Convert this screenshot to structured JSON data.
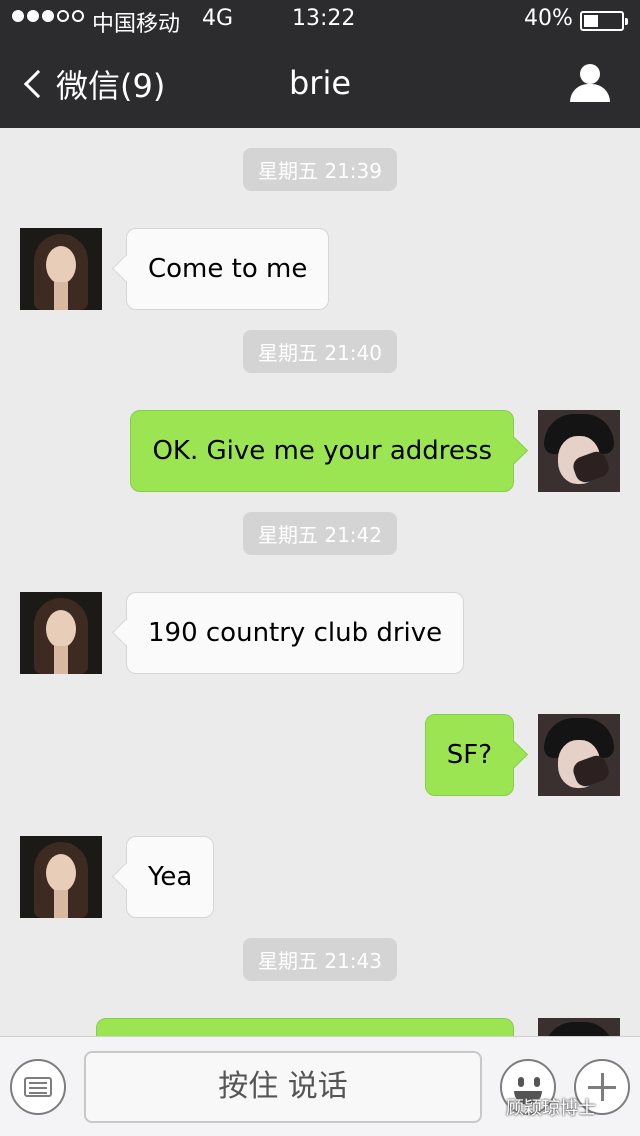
{
  "status_bar": {
    "signal_dots_filled": 3,
    "signal_dots_total": 5,
    "carrier": "中国移动",
    "network": "4G",
    "time": "13:22",
    "battery_percent_text": "40%",
    "battery_level": 0.4
  },
  "nav": {
    "back_label": "微信(9)",
    "title": "brie",
    "profile_icon": "person-icon"
  },
  "messages": [
    {
      "type": "time",
      "text": "星期五 21:39"
    },
    {
      "type": "in",
      "text": "Come to me"
    },
    {
      "type": "time",
      "text": "星期五 21:40"
    },
    {
      "type": "out",
      "text": "OK. Give me your address"
    },
    {
      "type": "time",
      "text": "星期五 21:42"
    },
    {
      "type": "in",
      "text": "190 country club drive"
    },
    {
      "type": "out",
      "text": "SF?"
    },
    {
      "type": "in",
      "text": "Yea"
    },
    {
      "type": "time",
      "text": "星期五 21:43"
    },
    {
      "type": "out",
      "text": ""
    }
  ],
  "input_bar": {
    "keyboard_icon": "keyboard-icon",
    "hold_to_talk_label": "按住 说话",
    "emoji_icon": "emoji-icon",
    "plus_icon": "plus-icon"
  },
  "watermark": "顾颖琼博士",
  "colors": {
    "nav_bg": "#2c2c2e",
    "chat_bg": "#ebebeb",
    "outgoing_bubble": "#9ce552",
    "incoming_bubble": "#fafafa"
  }
}
